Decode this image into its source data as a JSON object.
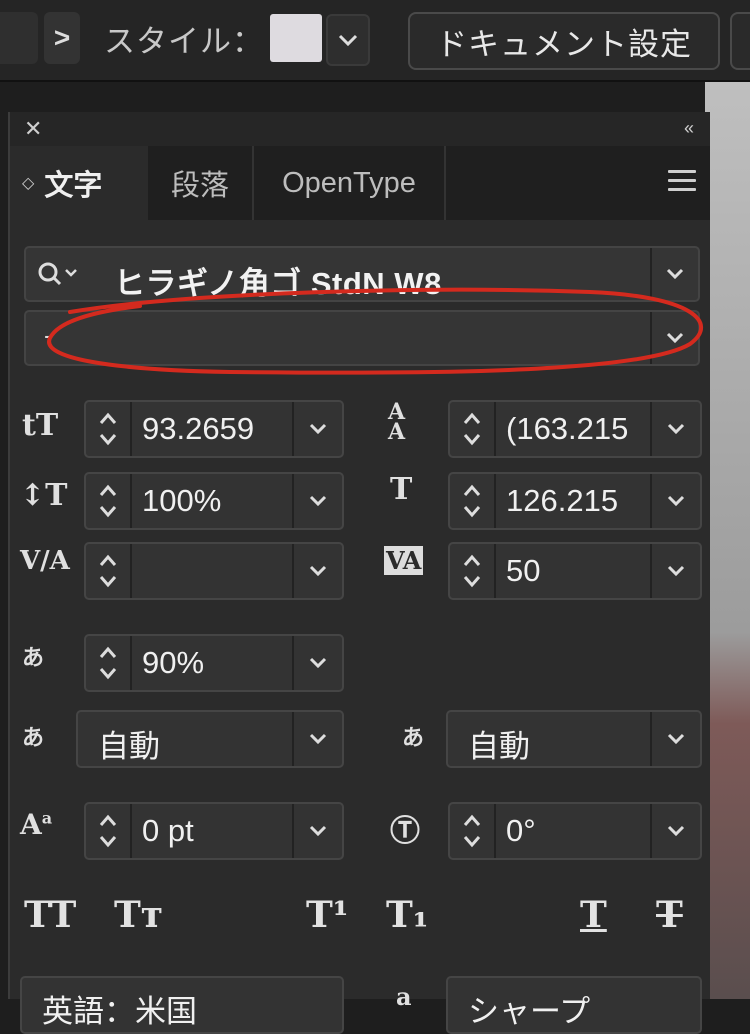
{
  "toolbar": {
    "next_arrow": ">",
    "style_label": "スタイル：",
    "swatch_color": "#dedbe0",
    "document_settings": "ドキュメント設定"
  },
  "panel": {
    "tabs": [
      "文字",
      "段落",
      "OpenType"
    ],
    "active_tab": "文字",
    "font_family": "ヒラギノ角ゴ StdN W8",
    "font_style": "",
    "fields": {
      "font_size": "93.2659",
      "leading": "(163.215",
      "vertical_scale": "100%",
      "horizontal_scale": "126.215",
      "kerning": "",
      "tracking": "50",
      "tsume": "90%",
      "aki_left": "自動",
      "aki_right": "自動",
      "baseline_shift": "0 pt",
      "rotation": "0°"
    },
    "bottom_row": [
      "TT",
      "Tт",
      "T¹",
      "T₁",
      "T",
      "T"
    ],
    "language": "英語：米国",
    "antialias": "シャープ"
  },
  "annotation": {
    "color": "#d42a1e"
  }
}
